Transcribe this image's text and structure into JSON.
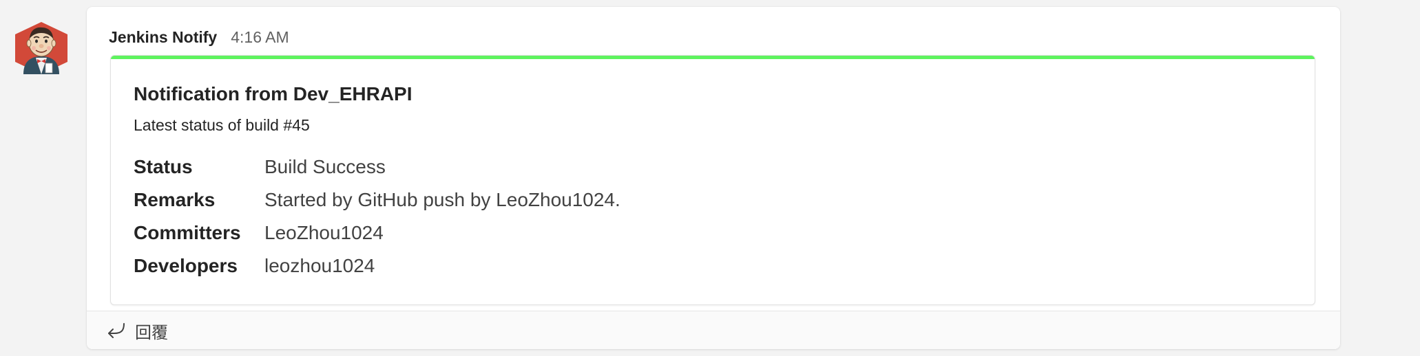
{
  "message": {
    "sender": "Jenkins Notify",
    "timestamp": "4:16 AM",
    "avatar_icon": "jenkins-butler-icon"
  },
  "card": {
    "accent_color": "#5ef35e",
    "title": "Notification from Dev_EHRAPI",
    "subtitle": "Latest status of build #45",
    "facts": [
      {
        "title": "Status",
        "value": "Build Success"
      },
      {
        "title": "Remarks",
        "value": "Started by GitHub push by LeoZhou1024."
      },
      {
        "title": "Committers",
        "value": "LeoZhou1024"
      },
      {
        "title": "Developers",
        "value": "leozhou1024"
      }
    ]
  },
  "reply": {
    "icon": "reply-arrow-icon",
    "label": "回覆"
  }
}
